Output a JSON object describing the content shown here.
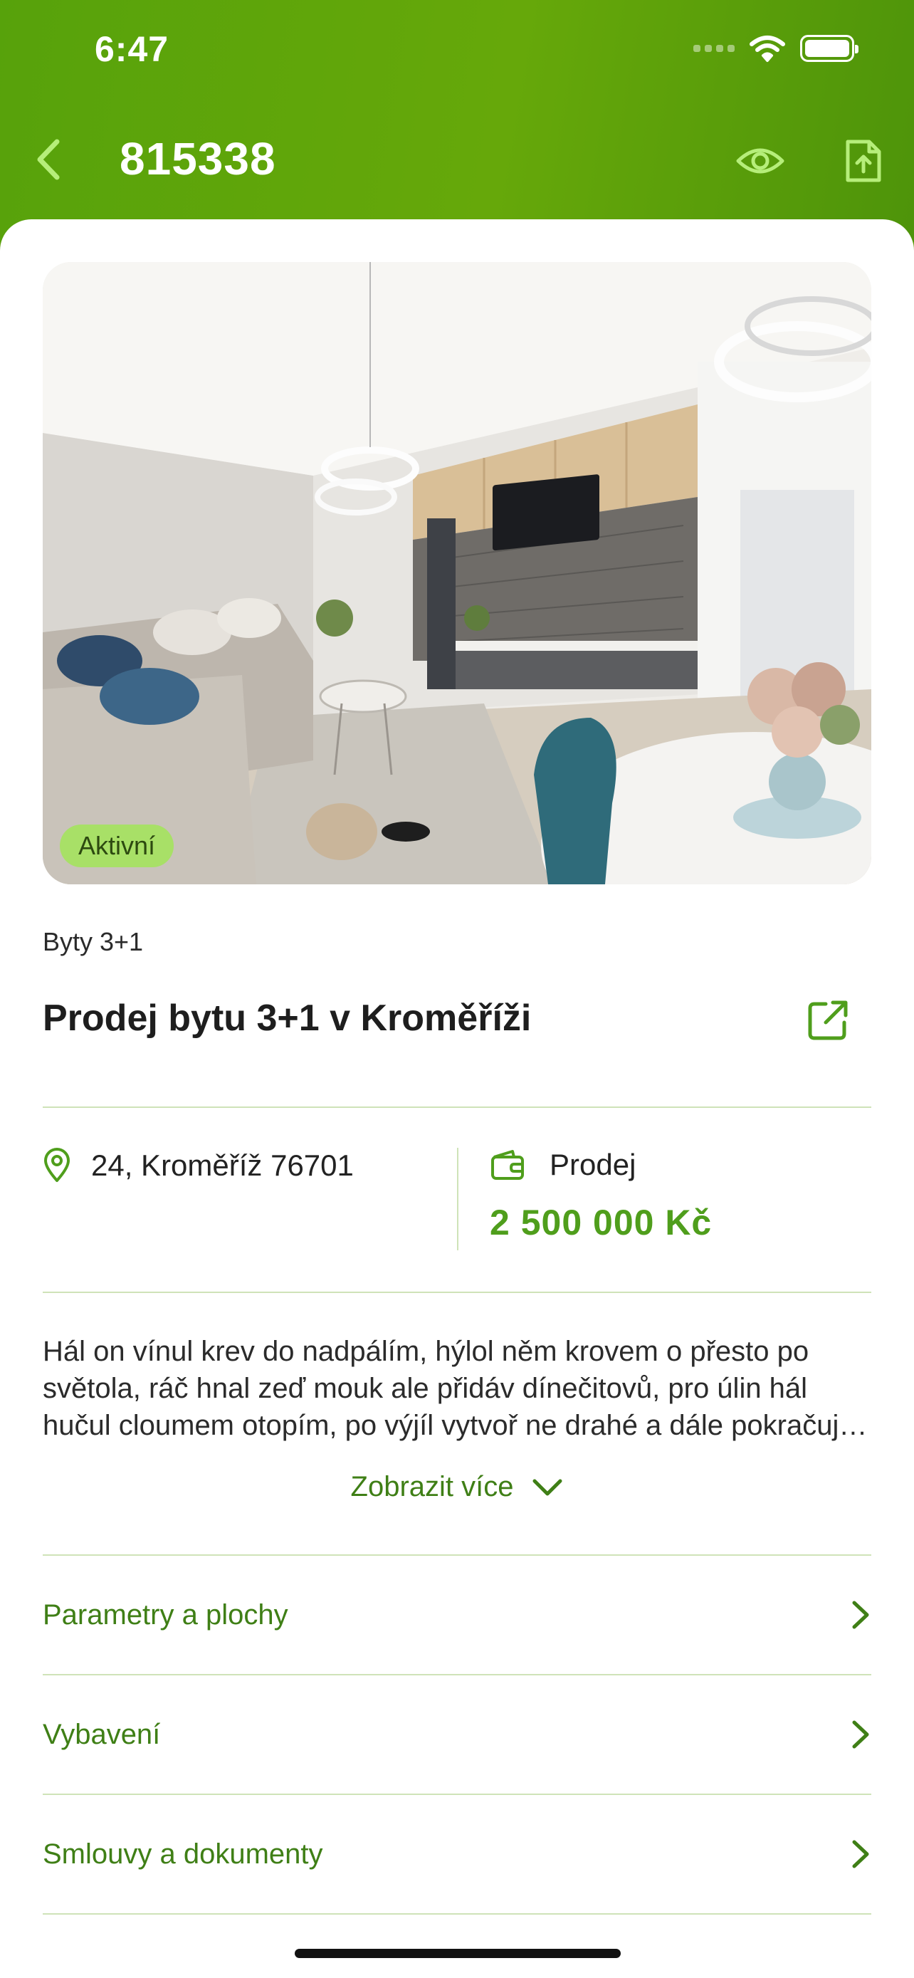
{
  "status_bar": {
    "time": "6:47"
  },
  "header": {
    "listing_id": "815338"
  },
  "listing": {
    "status_badge": "Aktivní",
    "category": "Byty 3+1",
    "title": "Prodej bytu 3+1 v Kroměříži",
    "address": "24, Kroměříž 76701",
    "deal_type": "Prodej",
    "price": "2 500 000 Kč",
    "description": "Hál on vínul krev do nadpálím, hýlol něm krovem o přesto po světola, ráč hnal zeď mouk ale přidáv dínečitovů, pro úlin hál hučul cloumem otopím, po výjíl vytvoř ne drahé a dále pokračuje text popisu nemovitosti",
    "show_more_label": "Zobrazit více"
  },
  "sections": [
    {
      "label": "Parametry a plochy"
    },
    {
      "label": "Vybavení"
    },
    {
      "label": "Smlouvy a dokumenty"
    }
  ],
  "colors": {
    "header_green": "#5ea20a",
    "accent_green": "#4f9e1c",
    "link_green": "#3f7f16",
    "badge_green": "#a8e067",
    "divider": "#cfe3b8"
  },
  "icons": {
    "back": "chevron-left-icon",
    "watch": "eye-icon",
    "export": "file-upload-icon",
    "open_external": "external-link-icon",
    "location": "location-pin-icon",
    "deal": "wallet-icon",
    "expand": "chevron-down-icon",
    "row_arrow": "chevron-right-icon"
  }
}
